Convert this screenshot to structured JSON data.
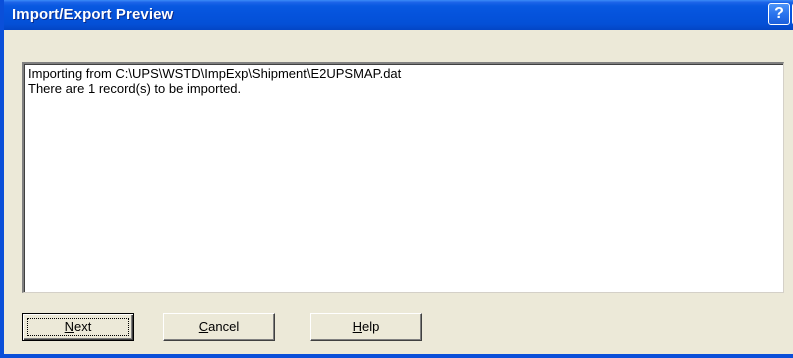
{
  "window": {
    "title": "Import/Export Preview",
    "help_glyph": "?",
    "close_glyph": "✕"
  },
  "preview": {
    "lines": [
      "Importing from C:\\UPS\\WSTD\\ImpExp\\Shipment\\E2UPSMAP.dat",
      "There are 1 record(s) to be imported."
    ]
  },
  "buttons": {
    "next": {
      "mnemonic": "N",
      "rest": "ext"
    },
    "cancel": {
      "mnemonic": "C",
      "rest": "ancel"
    },
    "help": {
      "mnemonic": "H",
      "rest": "elp"
    }
  },
  "colors": {
    "titlebar": "#0553dc",
    "dialog_bg": "#ece9d8",
    "close_button": "#d65c3b"
  }
}
